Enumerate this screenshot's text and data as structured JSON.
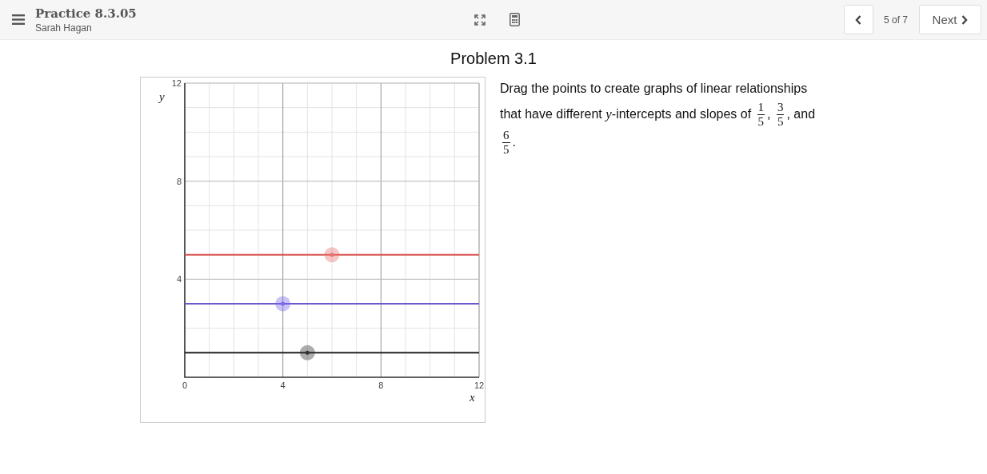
{
  "header": {
    "title": "Practice 8.3.05",
    "author": "Sarah Hagan",
    "page_indicator": "5 of 7",
    "next_button": "Next"
  },
  "problem": {
    "title": "Problem 3.1",
    "prompt": [
      {
        "kind": "text",
        "text": "Drag the points to create graphs of linear relationships that have different "
      },
      {
        "kind": "var",
        "text": "y"
      },
      {
        "kind": "text",
        "text": "-intercepts and slopes of "
      },
      {
        "kind": "frac",
        "num": "1",
        "den": "5"
      },
      {
        "kind": "text",
        "text": ", "
      },
      {
        "kind": "frac",
        "num": "3",
        "den": "5"
      },
      {
        "kind": "text",
        "text": ", and "
      },
      {
        "kind": "frac",
        "num": "6",
        "den": "5"
      },
      {
        "kind": "text",
        "text": "."
      }
    ]
  },
  "graph": {
    "chart_data": {
      "type": "line",
      "xlabel": "x",
      "ylabel": "y",
      "grid": true,
      "x": [
        0,
        4,
        5,
        6,
        12
      ],
      "xlim": [
        0,
        12
      ],
      "ylim": [
        0,
        12
      ],
      "xticks": [
        0,
        4,
        8,
        12
      ],
      "yticks": [
        4,
        8,
        12
      ],
      "series": [
        {
          "color": "#d9534f",
          "values": [
            5,
            5,
            5,
            5,
            5
          ]
        },
        {
          "color": "#6a5acd",
          "values": [
            3,
            3,
            3,
            3,
            3
          ]
        },
        {
          "color": "#222222",
          "values": [
            1,
            1,
            1,
            1,
            1
          ]
        },
        {
          "color": "#e57373",
          "marker": "circle",
          "values": [
            null,
            null,
            null,
            5,
            null
          ]
        },
        {
          "color": "#7b68ee",
          "marker": "circle",
          "values": [
            null,
            3,
            null,
            null,
            null
          ]
        },
        {
          "color": "#333333",
          "marker": "circle",
          "values": [
            null,
            null,
            1,
            null,
            null
          ]
        }
      ]
    }
  }
}
